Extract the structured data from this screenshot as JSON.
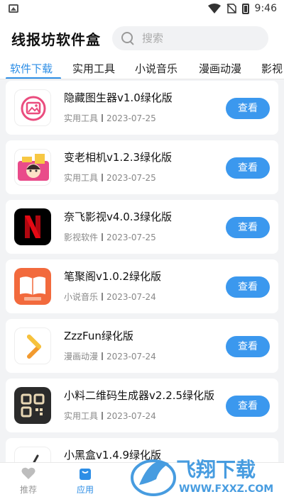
{
  "status": {
    "time": "9:46"
  },
  "header": {
    "title": "线报坊软件盒",
    "search_placeholder": "搜索"
  },
  "tabs": [
    {
      "label": "软件下载",
      "active": true
    },
    {
      "label": "实用工具",
      "active": false
    },
    {
      "label": "小说音乐",
      "active": false
    },
    {
      "label": "漫画动漫",
      "active": false
    },
    {
      "label": "影视",
      "active": false
    }
  ],
  "apps": [
    {
      "name": "隐藏图生器v1.0绿化版",
      "category": "实用工具",
      "date": "2023-07-25",
      "icon": "image-frame-icon",
      "button": "查看"
    },
    {
      "name": "变老相机v1.2.3绿化版",
      "category": "实用工具",
      "date": "2023-07-25",
      "icon": "camera-face-icon",
      "button": "查看"
    },
    {
      "name": "奈飞影视v4.0.3绿化版",
      "category": "影视软件",
      "date": "2023-07-25",
      "icon": "netflix-n-icon",
      "button": "查看"
    },
    {
      "name": "笔聚阁v1.0.2绿化版",
      "category": "小说音乐",
      "date": "2023-07-24",
      "icon": "book-icon",
      "button": "查看"
    },
    {
      "name": "ZzzFun绿化版",
      "category": "漫画动漫",
      "date": "2023-07-24",
      "icon": "chevron-play-icon",
      "button": "查看"
    },
    {
      "name": "小料二维码生成器v2.2.5绿化版",
      "category": "实用工具",
      "date": "2023-07-24",
      "icon": "qrcode-icon",
      "button": "查看"
    },
    {
      "name": "小黑盒v1.4.9绿化版",
      "category": "",
      "date": "",
      "icon": "pen-icon",
      "button": ""
    }
  ],
  "bottom_nav": [
    {
      "label": "推荐",
      "icon": "heart-icon",
      "active": false
    },
    {
      "label": "应用",
      "icon": "bag-icon",
      "active": true
    },
    {
      "label": "",
      "icon": "",
      "active": false
    },
    {
      "label": "",
      "icon": "",
      "active": false
    },
    {
      "label": "",
      "icon": "",
      "active": false
    }
  ],
  "watermark": {
    "text": "飞翔下载",
    "url": "WWW.FXXZ.COM"
  },
  "colors": {
    "accent": "#2d8ee6",
    "button": "#3b98ee"
  }
}
